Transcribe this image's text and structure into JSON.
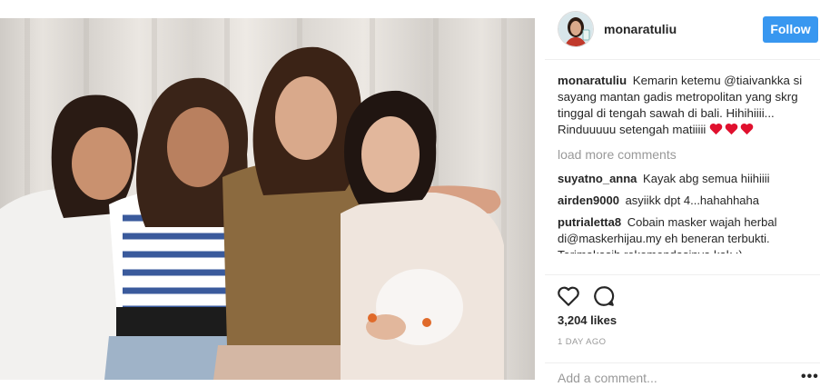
{
  "post": {
    "username": "monaratuliu",
    "follow_label": "Follow",
    "caption": "Kemarin ketemu @tiaivankka si sayang mantan gadis metropolitan yang skrg tinggal di tengah sawah di bali. Hihihiiii... Rinduuuuu setengah matiiiii",
    "caption_emoji": "red-heart-icon",
    "load_more": "load more comments",
    "likes": "3,204 likes",
    "time": "1 DAY AGO",
    "add_comment_placeholder": "Add a comment...",
    "more_options": "•••"
  },
  "comments": [
    {
      "username": "suyatno_anna",
      "text": "Kayak abg semua hiihiiii"
    },
    {
      "username": "airden9000",
      "text": "asyiikk dpt 4...hahahhaha"
    },
    {
      "username": "putrialetta8",
      "text": "Cobain masker wajah herbal di@maskerhijau.my eh beneran terbukti. Terimakasih rekomendasinya kak :)"
    }
  ],
  "icons": {
    "like": "heart-outline-icon",
    "comment": "comment-bubble-icon",
    "avatar": "profile-avatar"
  },
  "colors": {
    "follow_button": "#3897f0",
    "heart_emoji": "#e0102e",
    "muted_text": "#999999"
  }
}
